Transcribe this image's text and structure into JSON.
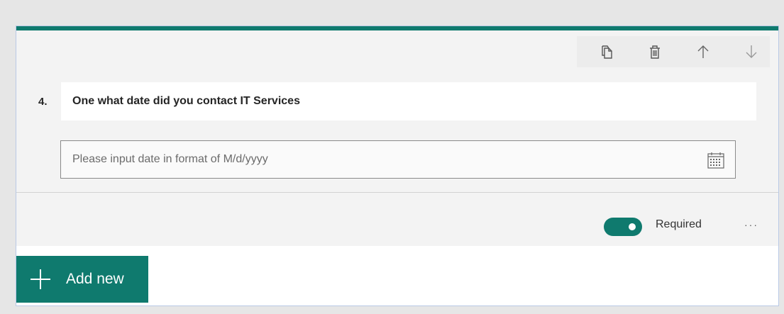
{
  "question": {
    "number": "4.",
    "title": "One what date did you contact IT Services",
    "date_placeholder": "Please input date in format of M/d/yyyy",
    "date_value": ""
  },
  "toolbar": {
    "icons": [
      "copy-icon",
      "delete-icon",
      "move-up-icon",
      "move-down-icon"
    ]
  },
  "footer": {
    "required_label": "Required",
    "required_enabled": true,
    "more_label": "···"
  },
  "add_new": {
    "label": "Add new"
  },
  "colors": {
    "accent": "#0f7a6e",
    "question_background": "#f3f3f3",
    "page_background": "#e6e6e6"
  }
}
